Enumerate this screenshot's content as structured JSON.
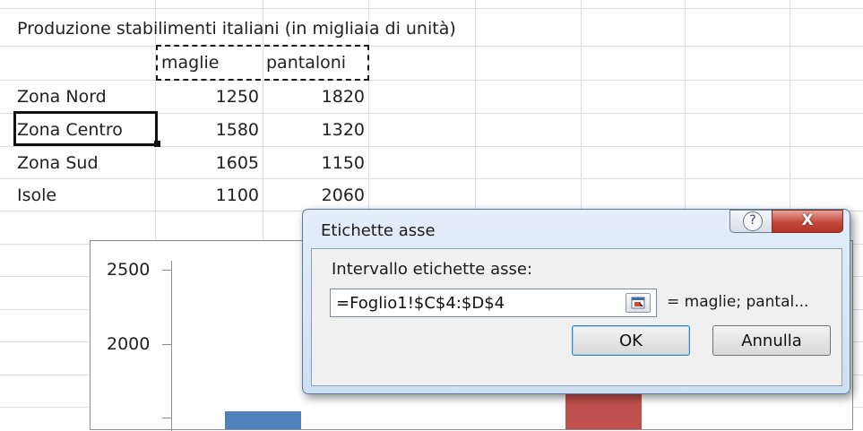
{
  "sheet": {
    "title": "Produzione stabilimenti italiani (in migliaia di unità)",
    "headers": [
      "maglie",
      "pantaloni"
    ],
    "rows": [
      {
        "label": "Zona Nord",
        "maglie": "1250",
        "pantaloni": "1820"
      },
      {
        "label": "Zona Centro",
        "maglie": "1580",
        "pantaloni": "1320"
      },
      {
        "label": "Zona Sud",
        "maglie": "1605",
        "pantaloni": "1150"
      },
      {
        "label": "Isole",
        "maglie": "1100",
        "pantaloni": "2060"
      }
    ]
  },
  "chart_data": {
    "type": "bar",
    "y_ticks": [
      "2500",
      "2000"
    ],
    "series_colors": [
      "#4f81bd",
      "#c0504d"
    ],
    "gridlines": false
  },
  "dialog": {
    "title": "Etichette asse",
    "help_icon": "?",
    "close_icon": "X",
    "field_label": "Intervallo etichette asse:",
    "field_value": "=Foglio1!$C$4:$D$4",
    "preview": "= maglie; pantal...",
    "ok_label": "OK",
    "cancel_label": "Annulla"
  }
}
